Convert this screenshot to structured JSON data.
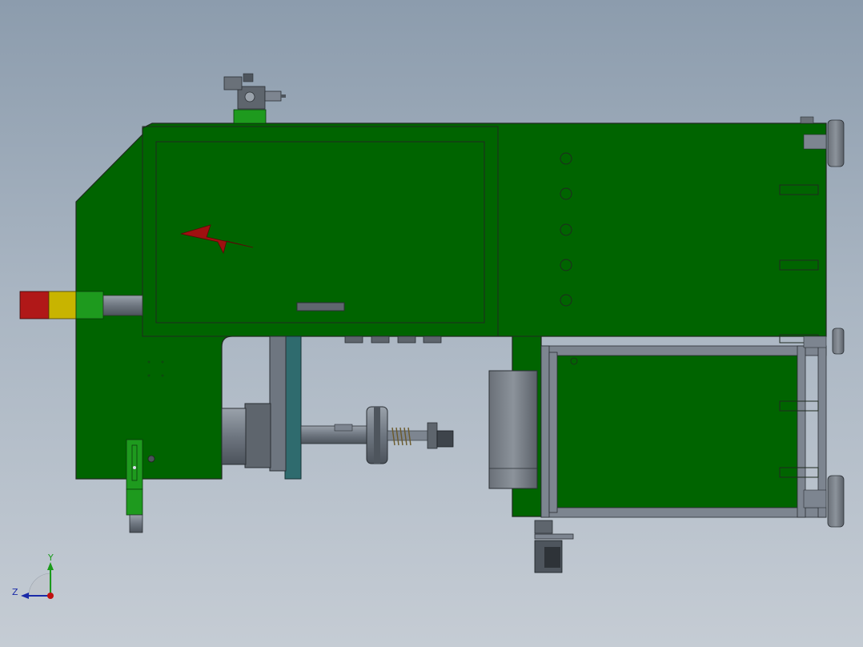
{
  "viewport": {
    "background_top": "#8c9cad",
    "background_bottom": "#c5ccd4"
  },
  "colors": {
    "body_green": "#006400",
    "panel_green": "#0b6e0b",
    "edge_dark": "#1f2a1f",
    "steel": "#7d8590",
    "steel_dark": "#4e555d",
    "teal": "#2f6b6e",
    "lightning_red": "#a01010",
    "beacon_red": "#b01818",
    "beacon_yellow": "#c8b400",
    "beacon_green": "#1e9a1e"
  },
  "icons": {
    "warning": "lightning-bolt-icon",
    "beacon": "signal-tower-light"
  },
  "triad": {
    "y_label": "Y",
    "z_label": "Z",
    "y_color": "#1a9a1a",
    "z_color": "#1a2aa8",
    "x_color": "#c01010"
  }
}
